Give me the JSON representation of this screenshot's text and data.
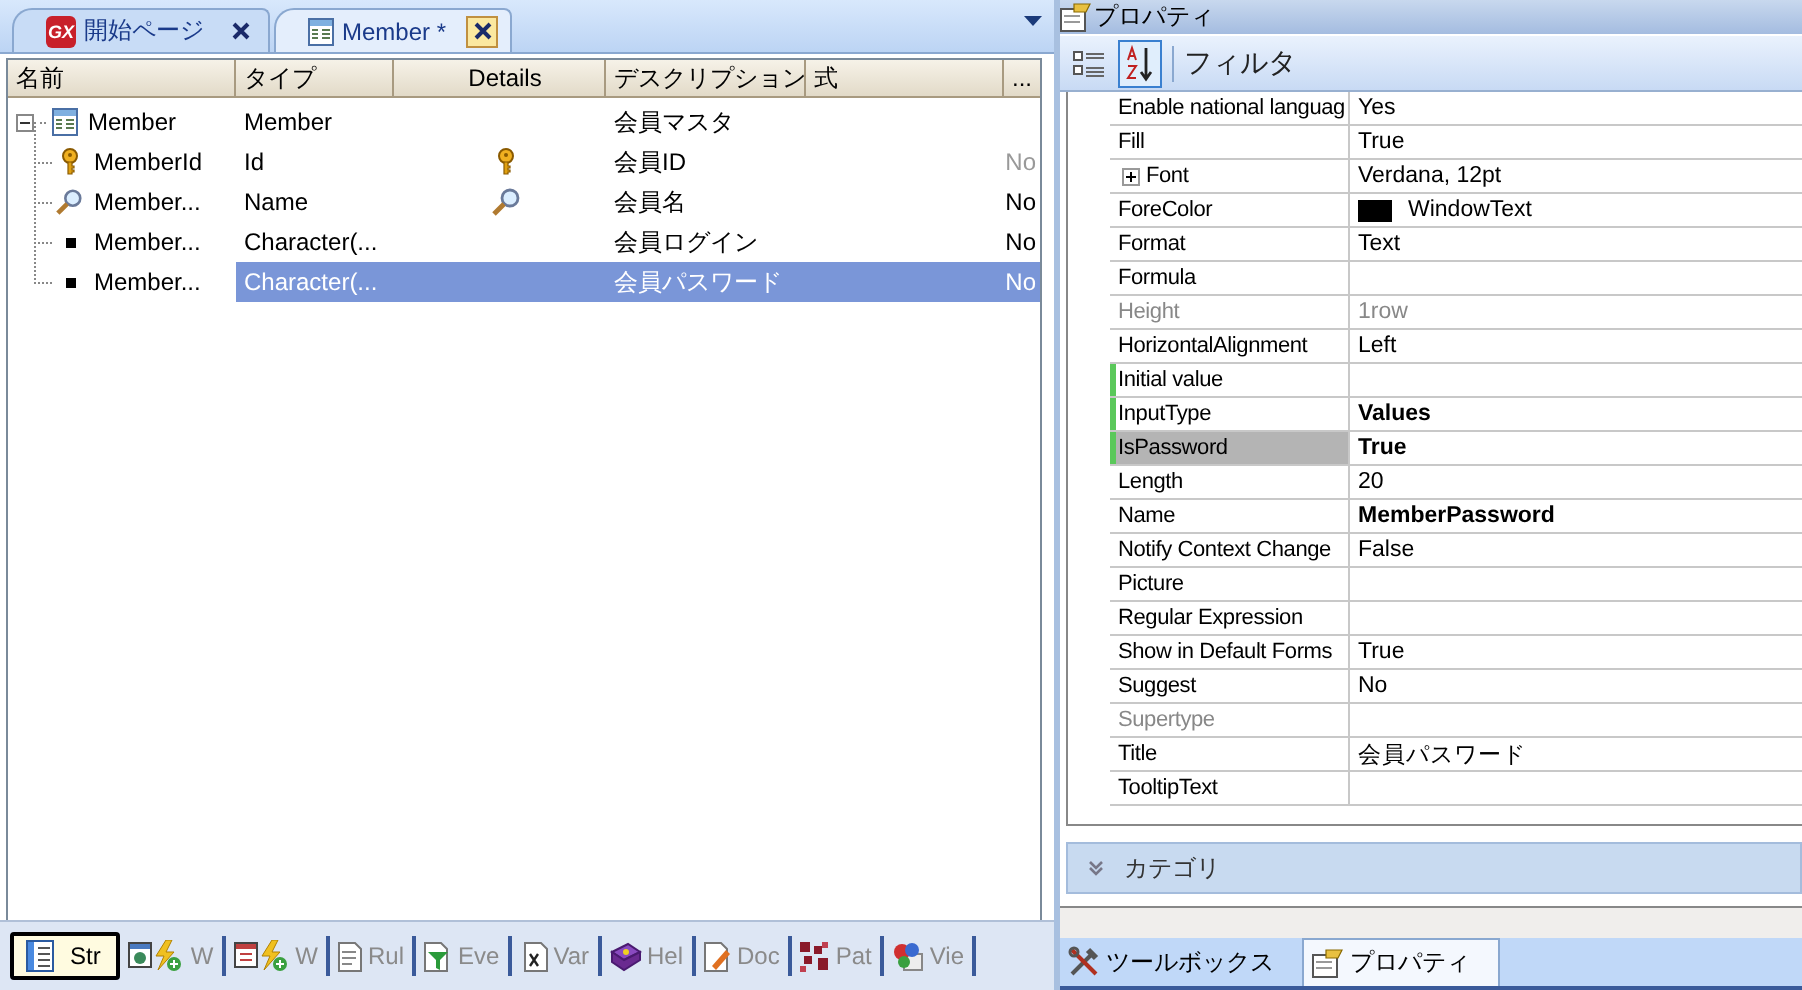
{
  "document_tabs": [
    {
      "label": "開始ページ",
      "kind": "start_page",
      "logo": "GX",
      "selected": false
    },
    {
      "label": "Member *",
      "kind": "transaction",
      "selected": true
    }
  ],
  "structure": {
    "columns": [
      "名前",
      "タイプ",
      "Details",
      "デスクリプション",
      "式",
      "..."
    ],
    "root": {
      "name": "Member",
      "type": "Member",
      "description": "会員マスタ",
      "expanded": true,
      "selected": false,
      "children": [
        {
          "name": "MemberId",
          "type": "Id",
          "kind": "primary_key",
          "description": "会員ID",
          "formula": "No",
          "formula_dimmed": true,
          "selected": false
        },
        {
          "name": "Member...",
          "type": "Name",
          "kind": "description_attribute",
          "description": "会員名",
          "formula": "No",
          "formula_dimmed": false,
          "selected": false
        },
        {
          "name": "Member...",
          "type": "Character(...",
          "kind": "attribute",
          "description": "会員ログイン",
          "formula": "No",
          "formula_dimmed": false,
          "selected": false
        },
        {
          "name": "Member...",
          "type": "Character(...",
          "kind": "attribute",
          "description": "会員パスワード",
          "formula": "No",
          "formula_dimmed": false,
          "selected": true
        }
      ]
    }
  },
  "bottom_tabs": [
    {
      "label": "Str",
      "kind": "structure",
      "selected": true,
      "disabled": false
    },
    {
      "label": "W",
      "kind": "webform",
      "selected": false,
      "disabled": true
    },
    {
      "label": "W",
      "kind": "winform",
      "selected": false,
      "disabled": true
    },
    {
      "label": "Rul",
      "kind": "rules",
      "selected": false,
      "disabled": true
    },
    {
      "label": "Eve",
      "kind": "events",
      "selected": false,
      "disabled": true
    },
    {
      "label": "Var",
      "kind": "variables",
      "selected": false,
      "disabled": true
    },
    {
      "label": "Hel",
      "kind": "help",
      "selected": false,
      "disabled": true
    },
    {
      "label": "Doc",
      "kind": "documentation",
      "selected": false,
      "disabled": true
    },
    {
      "label": "Pat",
      "kind": "patterns",
      "selected": false,
      "disabled": true
    },
    {
      "label": "Vie",
      "kind": "views",
      "selected": false,
      "disabled": true
    }
  ],
  "properties": {
    "title": "プロパティ",
    "filter_label": "フィルタ",
    "sorted_alphabetically": true,
    "rows": [
      {
        "name": "Enable national languag",
        "value": "Yes",
        "disabled": false,
        "modified": false,
        "marked": false,
        "selected": false,
        "expandable": false
      },
      {
        "name": "Fill",
        "value": "True",
        "disabled": false,
        "modified": false,
        "marked": false,
        "selected": false,
        "expandable": false
      },
      {
        "name": "Font",
        "value": "Verdana, 12pt",
        "disabled": false,
        "modified": false,
        "marked": false,
        "selected": false,
        "expandable": true
      },
      {
        "name": "ForeColor",
        "value": "WindowText",
        "kind": "color",
        "color": "#000000",
        "disabled": false,
        "modified": false,
        "marked": false,
        "selected": false,
        "expandable": false
      },
      {
        "name": "Format",
        "value": "Text",
        "disabled": false,
        "modified": false,
        "marked": false,
        "selected": false,
        "expandable": false
      },
      {
        "name": "Formula",
        "disabled": false,
        "marked": false,
        "selected": false,
        "expandable": false
      },
      {
        "name": "Height",
        "value": "1row",
        "disabled": true,
        "modified": false,
        "marked": false,
        "selected": false,
        "expandable": false
      },
      {
        "name": "HorizontalAlignment",
        "value": "Left",
        "disabled": false,
        "modified": false,
        "marked": false,
        "selected": false,
        "expandable": false
      },
      {
        "name": "Initial value",
        "disabled": false,
        "marked": true,
        "selected": false,
        "expandable": false
      },
      {
        "name": "InputType",
        "value": "Values",
        "disabled": false,
        "modified": true,
        "marked": true,
        "selected": false,
        "expandable": false
      },
      {
        "name": "IsPassword",
        "value": "True",
        "disabled": false,
        "modified": true,
        "marked": true,
        "selected": true,
        "expandable": false
      },
      {
        "name": "Length",
        "value": "20",
        "disabled": false,
        "modified": false,
        "marked": false,
        "selected": false,
        "expandable": false
      },
      {
        "name": "Name",
        "value": "MemberPassword",
        "disabled": false,
        "modified": true,
        "marked": false,
        "selected": false,
        "expandable": false
      },
      {
        "name": "Notify Context Change",
        "value": "False",
        "disabled": false,
        "modified": false,
        "marked": false,
        "selected": false,
        "expandable": false
      },
      {
        "name": "Picture",
        "disabled": false,
        "marked": false,
        "selected": false,
        "expandable": false
      },
      {
        "name": "Regular Expression",
        "disabled": false,
        "marked": false,
        "selected": false,
        "expandable": false
      },
      {
        "name": "Show in Default Forms",
        "value": "True",
        "disabled": false,
        "modified": false,
        "marked": false,
        "selected": false,
        "expandable": false
      },
      {
        "name": "Suggest",
        "value": "No",
        "disabled": false,
        "modified": false,
        "marked": false,
        "selected": false,
        "expandable": false
      },
      {
        "name": "Supertype",
        "disabled": true,
        "marked": false,
        "selected": false,
        "expandable": false
      },
      {
        "name": "Title",
        "value": "会員パスワード",
        "disabled": false,
        "modified": false,
        "marked": false,
        "selected": false,
        "expandable": false
      },
      {
        "name": "TooltipText",
        "disabled": false,
        "marked": false,
        "selected": false,
        "expandable": false
      }
    ],
    "category_label": "カテゴリ"
  },
  "tool_tabs": [
    {
      "label": "ツールボックス",
      "kind": "toolbox",
      "selected": false
    },
    {
      "label": "プロパティ",
      "kind": "properties",
      "selected": true
    }
  ]
}
